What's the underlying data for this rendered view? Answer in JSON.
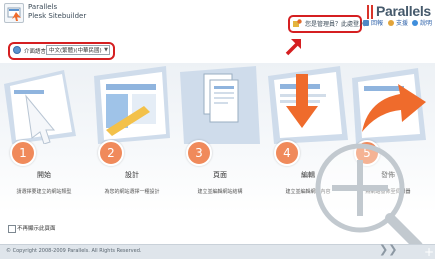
{
  "header": {
    "app_line1": "Parallels",
    "app_line2": "Plesk Sitebuilder",
    "brand": "Parallels",
    "login_link": "您是管理員？此處登入",
    "links": [
      {
        "label": "回報",
        "icon": "report-icon",
        "color": "#4f88c6"
      },
      {
        "label": "支援",
        "icon": "support-icon",
        "color": "#e2a43a"
      },
      {
        "label": "說明",
        "icon": "help-icon",
        "color": "#3f8edc"
      }
    ]
  },
  "language": {
    "label": "介面語言",
    "selected": "中文(繁體)(中華民國)"
  },
  "steps": [
    {
      "number": "1",
      "title": "開始",
      "desc": "請選擇要建立的網站類型"
    },
    {
      "number": "2",
      "title": "設計",
      "desc": "為您的網站選擇一種設計"
    },
    {
      "number": "3",
      "title": "頁面",
      "desc": "建立並編輯網站結構"
    },
    {
      "number": "4",
      "title": "編輯",
      "desc": "建立並編輯網站內容"
    },
    {
      "number": "5",
      "title": "發佈",
      "desc": "將網站發佈至伺服器"
    }
  ],
  "footer": {
    "checkbox_label": "不再顯示此頁面",
    "copyright": "© Copyright 2008-2009 Parallels. All Rights Reserved."
  },
  "colors": {
    "accent_red": "#d51f21",
    "step_orange": "#f08a5b",
    "brand_text": "#465a6c"
  }
}
